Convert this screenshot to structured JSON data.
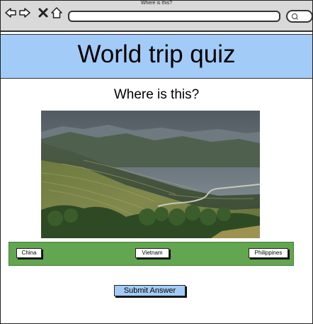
{
  "browser": {
    "title": "Where is this?"
  },
  "header": {
    "title": "World trip quiz"
  },
  "quiz": {
    "question": "Where is this?",
    "image_icon": "landscape-photo",
    "options": [
      {
        "label": "China"
      },
      {
        "label": "Vietnam"
      },
      {
        "label": "Philippines"
      }
    ],
    "submit_label": "Submit Answer"
  },
  "colors": {
    "header_bg": "#a3cbf7",
    "answer_bar": "#62a650",
    "submit_bg": "#a3cbf7"
  }
}
